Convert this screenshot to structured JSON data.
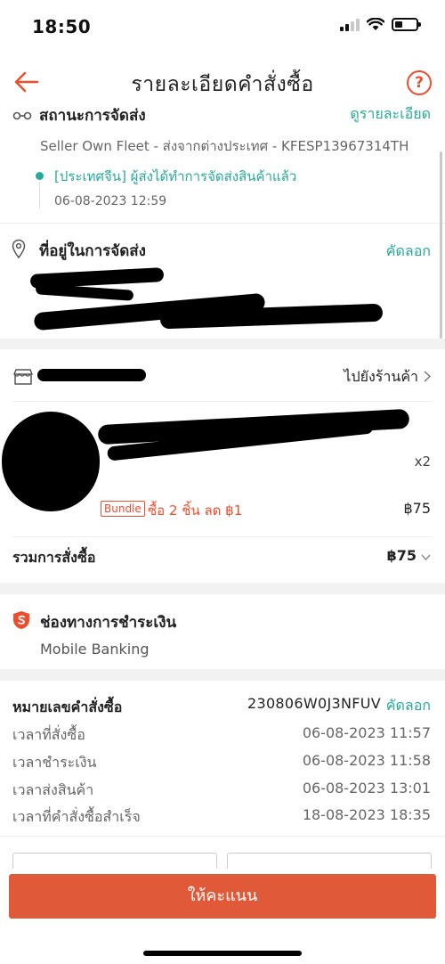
{
  "status_bar": {
    "time": "18:50",
    "battery_level": 0.35
  },
  "header": {
    "title": "รายละเอียดคำสั่งซื้อ",
    "help": "?"
  },
  "shipping": {
    "title": "สถานะการจัดส่ง",
    "detail_link": "ดูรายละเอียด",
    "carrier": "Seller Own Fleet - ส่งจากต่างประเทศ - KFESP13967314TH",
    "track_status": "[ประเทศจีน] ผู้ส่งได้ทำการจัดส่งสินค้าแล้ว",
    "track_time": "06-08-2023 12:59"
  },
  "address": {
    "title": "ที่อยู่ในการจัดส่ง",
    "copy": "คัดลอก"
  },
  "shop": {
    "link": "ไปยังร้านค้า",
    "qty": "x2",
    "bundle_tag": "Bundle",
    "bundle_text": "ซื้อ 2 ชิ้น ลด ฿1",
    "price": "฿75",
    "total_label": "รวมการสั่งซื้อ",
    "total_value": "฿75"
  },
  "payment": {
    "title": "ช่องทางการชำระเงิน",
    "method": "Mobile Banking"
  },
  "order": {
    "label": "หมายเลขคำสั่งซื้อ",
    "number": "230806W0J3NFUV",
    "copy": "คัดลอก",
    "rows": [
      {
        "label": "เวลาที่สั่งซื้อ",
        "value": "06-08-2023 11:57"
      },
      {
        "label": "เวลาชำระเงิน",
        "value": "06-08-2023 11:58"
      },
      {
        "label": "เวลาส่งสินค้า",
        "value": "06-08-2023 13:01"
      },
      {
        "label": "เวลาที่คำสั่งซื้อสำเร็จ",
        "value": "18-08-2023 18:35"
      }
    ]
  },
  "rate_button": "ให้คะแนน",
  "colors": {
    "accent": "#ee4d2d",
    "link": "#26aa99",
    "button": "#e05a3a"
  }
}
